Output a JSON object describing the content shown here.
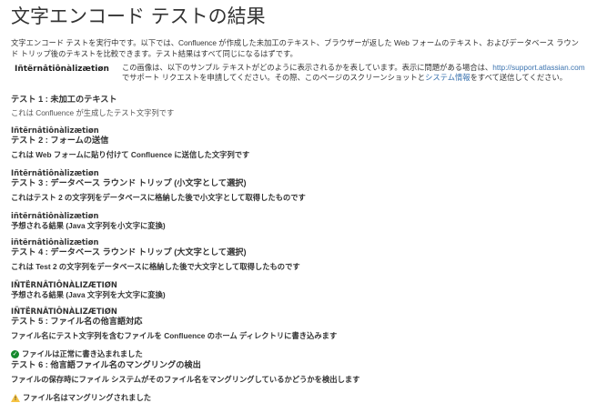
{
  "title": "文字エンコード テストの結果",
  "intro": "文字エンコード テストを実行中です。以下では、Confluence が作成した未加工のテキスト、ブラウザーが返した Web フォームのテキスト、およびデータベース ラウンド トリップ後のテキストを比較できます。テスト結果はすべて同じになるはずです。",
  "sample": {
    "image_text": "Iñtërnâtiônàlizætiøn",
    "text_before_link": "この画像は、以下のサンプル テキストがどのように表示されるかを表しています。表示に問題がある場合は、",
    "support_link": "http://support.atlassian.com",
    "text_middle": " でサポート リクエストを申請してください。その際、このページのスクリーンショットと",
    "sysinfo_link": "システム情報",
    "text_after": "をすべて送信してください。"
  },
  "tests": {
    "t1": {
      "title": "テスト 1 : 未加工のテキスト",
      "desc": "これは Confluence が生成したテスト文字列です",
      "value": "Iñtërnâtiônàlizætiøn"
    },
    "t2": {
      "title": "テスト 2 : フォームの送信",
      "desc": "これは Web フォームに貼り付けて Confluence に送信した文字列です",
      "value": "Iñtërnâtiônàlizætiøn"
    },
    "t3": {
      "title": "テスト 3 : データベース ラウンド トリップ (小文字として選択)",
      "desc": "これはテスト 2 の文字列をデータベースに格納した後で小文字として取得したものです",
      "value": "iñtërnâtiônàlizætiøn",
      "expected_label": "予想される結果 (Java 文字列を小文字に変換)",
      "expected": "iñtërnâtiônàlizætiøn"
    },
    "t4": {
      "title": "テスト 4 : データベース ラウンド トリップ (大文字として選択)",
      "desc": "これは Test 2 の文字列をデータベースに格納した後で大文字として取得したものです",
      "value": "IÑTËRNÂTIÔNÀLIZÆTIØN",
      "expected_label": "予想される結果 (Java 文字列を大文字に変換)",
      "expected": "IÑTËRNÂTIÔNÀLIZÆTIØN"
    },
    "t5": {
      "title": "テスト 5 : ファイル名の他言語対応",
      "desc": "ファイル名にテスト文字列を含むファイルを Confluence のホーム ディレクトリに書き込みます",
      "status": "ファイルは正常に書き込まれました",
      "status_icon": "check-circle-icon",
      "status_color": "#14892c"
    },
    "t6": {
      "title": "テスト 6 : 他言語ファイル名のマングリングの検出",
      "desc": "ファイルの保存時にファイル システムがそのファイル名をマングリングしているかどうかを検出します",
      "status": "ファイル名はマングリングされました",
      "status_icon": "warning-icon",
      "status_color": "#f6c342"
    }
  }
}
